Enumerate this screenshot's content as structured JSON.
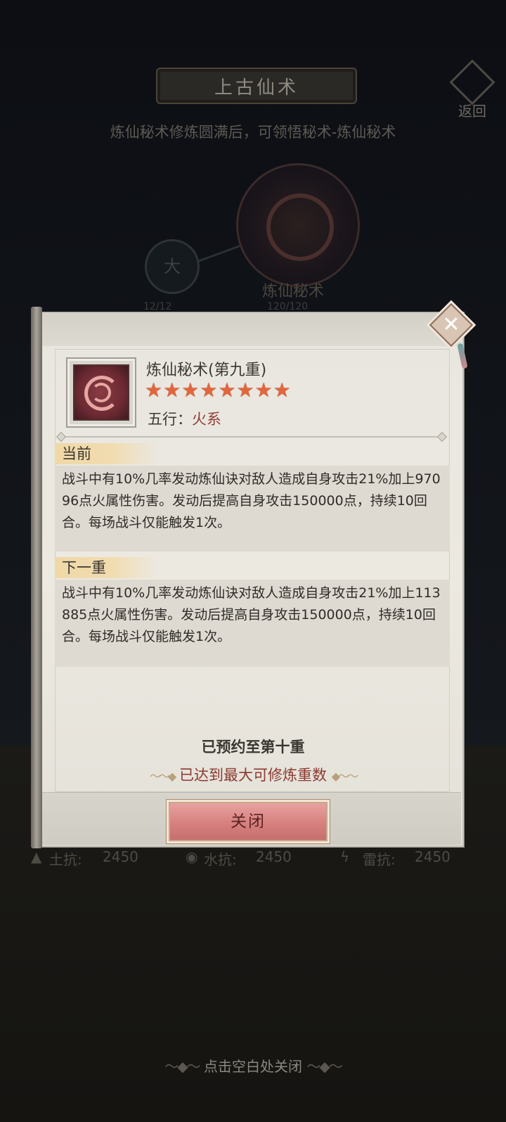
{
  "background": {
    "title": "上古仙术",
    "back_label": "返回",
    "subtitle": "炼仙秘术修炼圆满后，可领悟秘术-炼仙秘术",
    "small_node_glyph": "大",
    "small_node_count": "12/12",
    "emblem_name": "炼仙秘术",
    "emblem_count": "120/120",
    "resistances": [
      {
        "icon": "mountain-icon",
        "label": "土抗:",
        "value": "2450"
      },
      {
        "icon": "water-icon",
        "label": "水抗:",
        "value": "2450"
      },
      {
        "icon": "lightning-icon",
        "label": "雷抗:",
        "value": "2450"
      }
    ],
    "hint": "点击空白处关闭"
  },
  "modal": {
    "skill_name": "炼仙秘术(第九重)",
    "stars": 8,
    "element_label": "五行：",
    "element_value": "火系",
    "current": {
      "tag": "当前",
      "text": "战斗中有10%几率发动炼仙诀对敌人造成自身攻击21%加上97096点火属性伤害。发动后提高自身攻击150000点，持续10回合。每场战斗仅能触发1次。"
    },
    "next": {
      "tag": "下一重",
      "text": "战斗中有10%几率发动炼仙诀对敌人造成自身攻击21%加上113885点火属性伤害。发动后提高自身攻击150000点，持续10回合。每场战斗仅能触发1次。"
    },
    "reserved": "已预约至第十重",
    "max_notice": "已达到最大可修炼重数",
    "close_label": "关闭"
  },
  "colors": {
    "star": "#e2663d",
    "element": "#8e3f36",
    "max_notice": "#8b3a30",
    "button": "#d6807f",
    "tag": "#f0d8a6"
  }
}
